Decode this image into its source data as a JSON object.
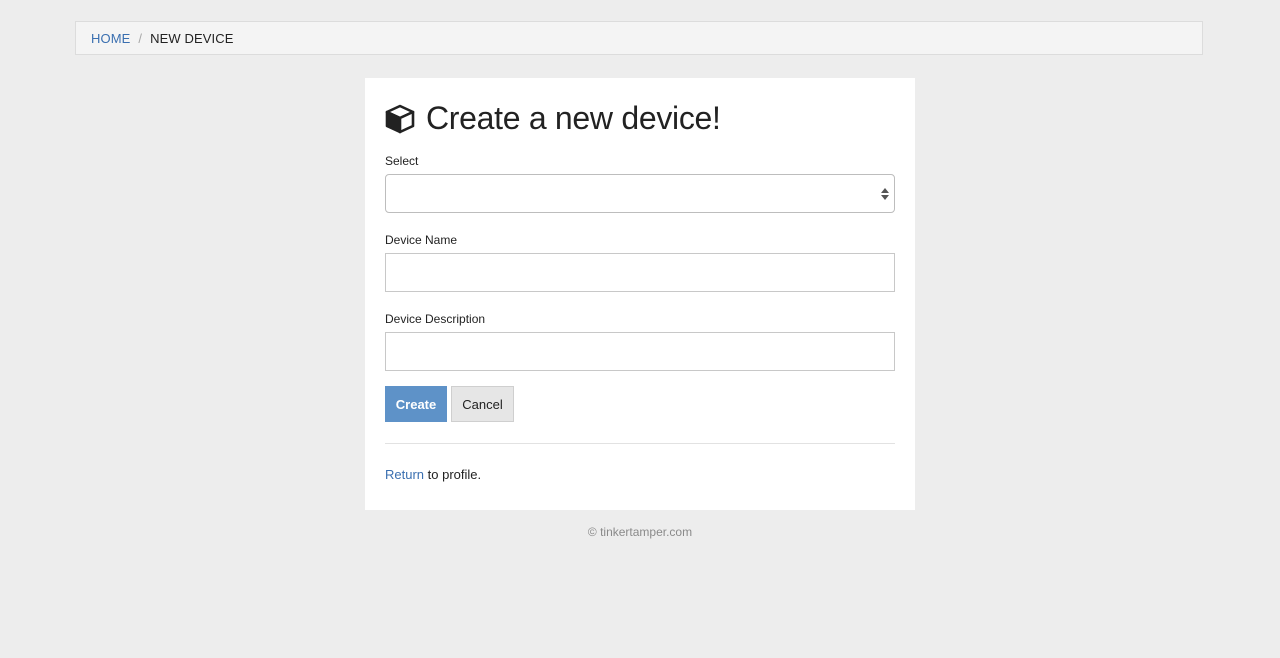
{
  "breadcrumb": {
    "home_label": "HOME",
    "separator": "/",
    "current_label": "NEW DEVICE"
  },
  "form": {
    "title": "Create a new device!",
    "title_icon": "cube-icon",
    "select": {
      "label": "Select",
      "value": "",
      "icon": "select-arrows-icon"
    },
    "device_name": {
      "label": "Device Name",
      "value": "",
      "placeholder": ""
    },
    "device_description": {
      "label": "Device Description",
      "value": "",
      "placeholder": ""
    },
    "create_label": "Create",
    "cancel_label": "Cancel",
    "return_link": "Return",
    "return_suffix": " to profile."
  },
  "footer": {
    "text": "© tinkertamper.com"
  },
  "colors": {
    "background": "#ededed",
    "link": "#3a6fb0",
    "primary_button": "#5e92c8",
    "secondary_button": "#e6e6e6"
  }
}
